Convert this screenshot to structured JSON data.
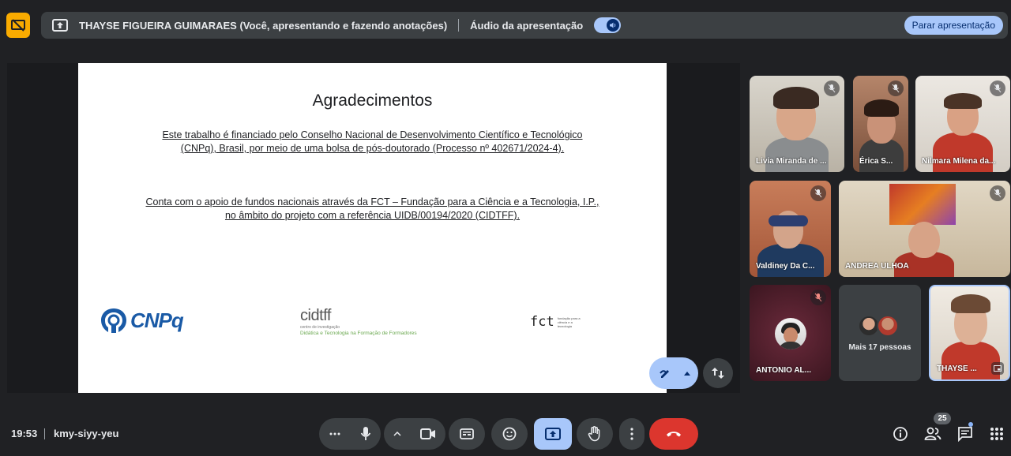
{
  "presenting_bar": {
    "presenter_text": "THAYSE FIGUEIRA GUIMARAES (Você, apresentando e fazendo anotações)",
    "audio_label": "Áudio da apresentação",
    "audio_on": true,
    "stop_label": "Parar apresentação"
  },
  "slide": {
    "title": "Agradecimentos",
    "paragraph1_line1": "Este trabalho é financiado pelo Conselho Nacional de Desenvolvimento Científico e Tecnológico",
    "paragraph1_line2": "(CNPq), Brasil, por meio de uma bolsa de pós-doutorado (Processo nº 402671/2024-4).",
    "paragraph2_line1": "Conta com o apoio de fundos nacionais através da FCT – Fundação para a Ciência e a Tecnologia, I.P.,",
    "paragraph2_line2": "no âmbito do projeto com a referência UIDB/00194/2020 (CIDTFF).",
    "logos": {
      "cnpq": "CNPq",
      "cidtff": "cidtff",
      "cidtff_sub1": "centro de investigação",
      "cidtff_sub2": "Didática e Tecnologia na Formação de Formadores",
      "fct": "fct",
      "fct_sub": "fundação para a ciência e a tecnologia"
    }
  },
  "participants": [
    {
      "name": "Livia Miranda de ..."
    },
    {
      "name": "Érica S..."
    },
    {
      "name": "Nilmara Milena da..."
    },
    {
      "name": "Valdiney Da C..."
    },
    {
      "name": "ANDREA ULHOA"
    },
    {
      "name": "ANTONIO AL..."
    },
    {
      "name": "THAYSE ..."
    }
  ],
  "more_people": "Mais 17 pessoas",
  "meeting": {
    "time": "19:53",
    "code": "kmy-siyy-yeu",
    "people_count": "25"
  },
  "colors": {
    "accent": "#a8c7fa",
    "leave": "#dc362e",
    "warning": "#f9ab00",
    "bar": "#3c4043",
    "background": "#202124"
  }
}
